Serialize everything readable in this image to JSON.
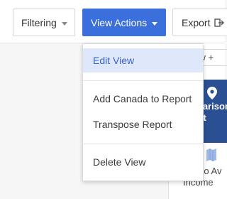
{
  "toolbar": {
    "filtering_label": "Filtering",
    "view_actions_label": "View Actions",
    "export_label": "Export"
  },
  "dropdown": {
    "items": [
      {
        "label": "Edit View",
        "active": true
      },
      {
        "label": "Add Canada to Report",
        "active": false
      },
      {
        "label": "Transpose Report",
        "active": false
      },
      {
        "label": "Delete View",
        "active": false
      }
    ]
  },
  "background_panel": {
    "view_tab_label": "View +",
    "blue_card_label": "Comparison\nReport",
    "light_card_label": "Ave to Av\nIncome"
  },
  "colors": {
    "accent": "#3b6fdc",
    "menu_highlight": "#dfe7fb",
    "card_blue": "#2b4f93"
  },
  "icons": [
    "chevron-down-icon",
    "export-icon",
    "pin-icon",
    "map-icon"
  ]
}
